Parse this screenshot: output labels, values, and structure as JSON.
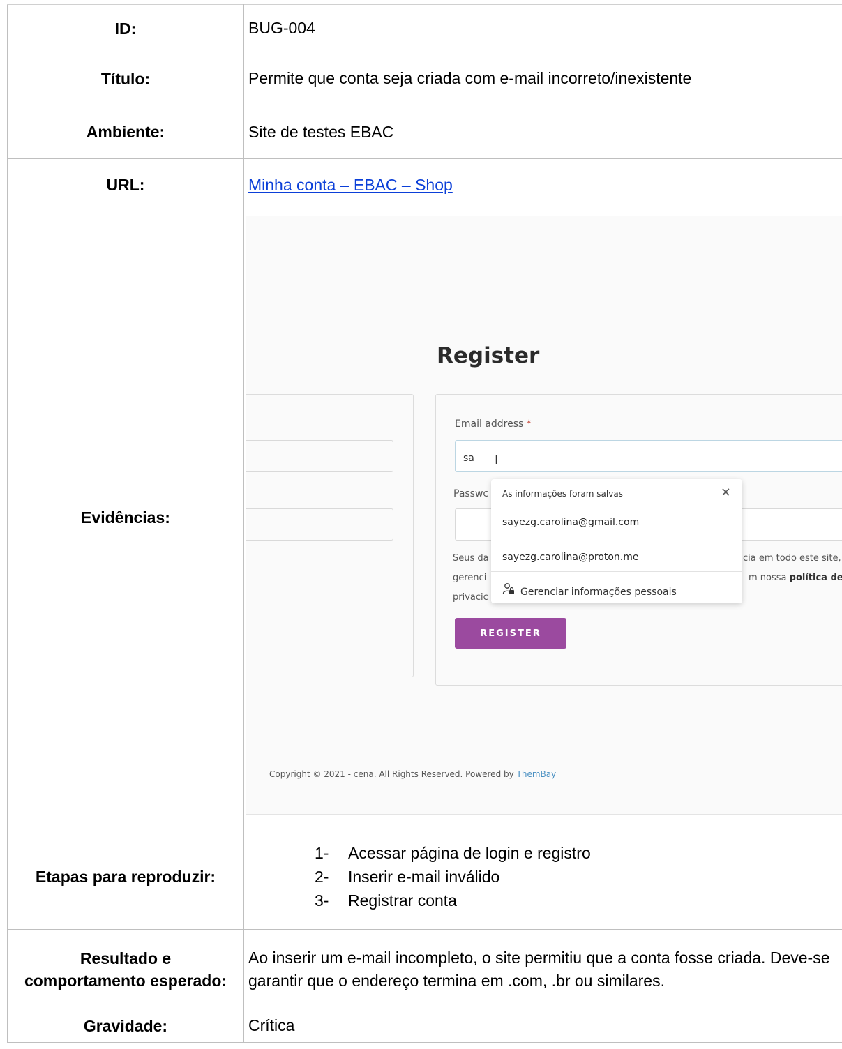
{
  "rows": {
    "id": {
      "label": "ID:",
      "value": "BUG-004"
    },
    "title": {
      "label": "Título:",
      "value": "Permite que conta seja criada com e-mail incorreto/inexistente"
    },
    "environment": {
      "label": "Ambiente:",
      "value": "Site de testes EBAC"
    },
    "url": {
      "label": "URL:",
      "value": "Minha conta – EBAC – Shop"
    },
    "evidence": {
      "label": "Evidências:"
    },
    "steps": {
      "label": "Etapas para reproduzir:",
      "items": [
        {
          "num": "1-",
          "text": "Acessar página de login e registro"
        },
        {
          "num": "2-",
          "text": "Inserir e-mail inválido"
        },
        {
          "num": "3-",
          "text": "Registrar conta"
        }
      ]
    },
    "result": {
      "label": "Resultado e comportamento esperado:",
      "value": "Ao inserir um e-mail incompleto, o site permitiu que a conta fosse criada. Deve-se garantir que o endereço termina em .com, .br ou similares."
    },
    "severity": {
      "label": "Gravidade:",
      "value": "Crítica"
    }
  },
  "screenshot": {
    "heading": "Register",
    "email_label": "Email address",
    "required_mark": "*",
    "email_value": "sa",
    "ibeam": "I",
    "password_label": "Passwc",
    "privacy_lines": [
      {
        "left": "Seus da",
        "right": "cia em todo este site,"
      },
      {
        "left": "gerenci",
        "right_plain": "m nossa ",
        "right_link": "política de"
      },
      {
        "left": "privacic"
      }
    ],
    "register_button": "REGISTER",
    "autofill": {
      "header": "As informações foram salvas",
      "close": "×",
      "options": [
        "sayezg.carolina@gmail.com",
        "sayezg.carolina@proton.me"
      ],
      "manage": "Gerenciar informações pessoais",
      "manage_icon": "person-lock-icon"
    },
    "copyright_text": "Copyright © 2021 - cena. All Rights Reserved. Powered by ",
    "copyright_link": "ThemBay"
  }
}
